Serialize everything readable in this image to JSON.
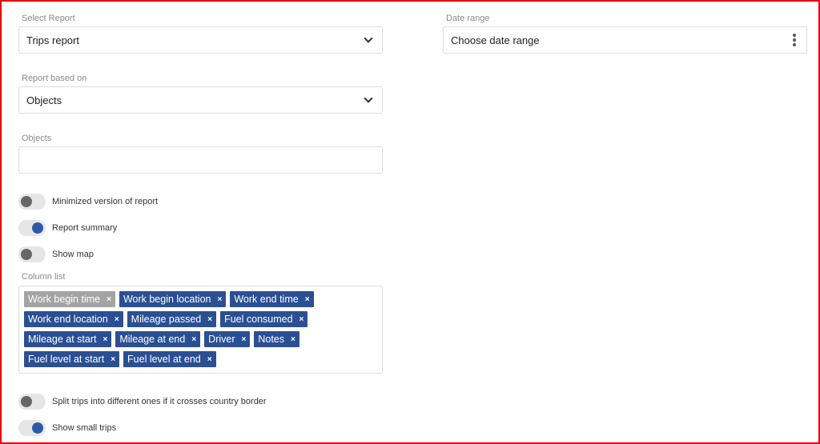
{
  "report": {
    "label": "Select Report",
    "value": "Trips report"
  },
  "date_range": {
    "label": "Date range",
    "placeholder": "Choose date range"
  },
  "based_on": {
    "label": "Report based on",
    "value": "Objects"
  },
  "objects": {
    "label": "Objects",
    "value": ""
  },
  "toggles": [
    {
      "label": "Minimized version of report",
      "on": false
    },
    {
      "label": "Report summary",
      "on": true
    },
    {
      "label": "Show map",
      "on": false
    }
  ],
  "column_list": {
    "label": "Column list",
    "rows": [
      [
        {
          "label": "Work begin time",
          "style": "grey"
        },
        {
          "label": "Work begin location"
        },
        {
          "label": "Work end time"
        }
      ],
      [
        {
          "label": "Work end location"
        },
        {
          "label": "Mileage passed"
        },
        {
          "label": "Fuel consumed"
        }
      ],
      [
        {
          "label": "Mileage at start"
        },
        {
          "label": "Mileage at end"
        },
        {
          "label": "Driver"
        },
        {
          "label": "Notes"
        }
      ],
      [
        {
          "label": "Fuel level at start"
        },
        {
          "label": "Fuel level at end"
        }
      ]
    ],
    "remove_glyph": "×"
  },
  "bottom_toggles": [
    {
      "label": "Split trips into different ones if it crosses country border",
      "on": false
    },
    {
      "label": "Show small trips",
      "on": true
    }
  ]
}
